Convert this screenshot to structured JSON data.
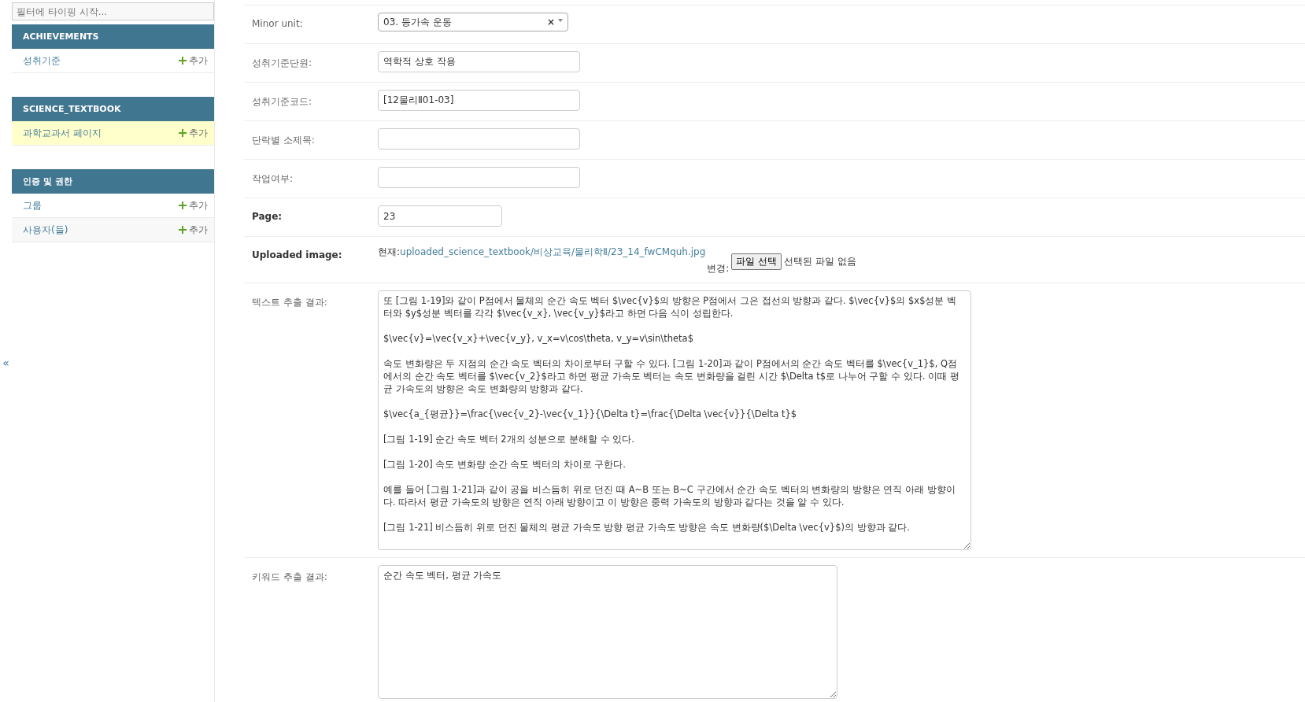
{
  "collapse_toggle": "«",
  "sidebar": {
    "filter": {
      "placeholder": "필터에 타이핑 시작..."
    },
    "sections": [
      {
        "caption": "ACHIEVEMENTS",
        "items": [
          {
            "name": "성취기준",
            "add": "추가",
            "selected": false
          }
        ]
      },
      {
        "caption": "SCIENCE_TEXTBOOK",
        "items": [
          {
            "name": "과학교과서 페이지",
            "add": "추가",
            "selected": true
          }
        ]
      },
      {
        "caption": "인증 및 권한",
        "items": [
          {
            "name": "그룹",
            "add": "추가",
            "selected": false
          },
          {
            "name": "사용자(들)",
            "add": "추가",
            "selected": false
          }
        ]
      }
    ]
  },
  "form": {
    "fields": [
      {
        "kind": "select",
        "label": "Minor unit:",
        "required": false,
        "value": "03. 등가속 운동",
        "clear": "×"
      },
      {
        "kind": "text",
        "label": "성취기준단원:",
        "required": false,
        "value": "역학적 상호 작용"
      },
      {
        "kind": "text",
        "label": "성취기준코드:",
        "required": false,
        "value": "[12물리Ⅱ01-03]"
      },
      {
        "kind": "text",
        "label": "단락별 소제목:",
        "required": false
      },
      {
        "kind": "text",
        "label": "작업여부:",
        "required": false
      },
      {
        "kind": "number",
        "label": "Page:",
        "required": true,
        "value": "23"
      },
      {
        "kind": "file",
        "label": "Uploaded image:",
        "required": true,
        "current_label": "현재:",
        "current_link": "uploaded_science_textbook/비상교육/물리학Ⅱ/23_14_fwCMquh.jpg",
        "change_label": "변경:",
        "button": "파일 선택",
        "status": "선택된 파일 없음"
      },
      {
        "kind": "textarea",
        "label": "텍스트 추출 결과:",
        "required": false,
        "value": "또 [그림 1-19]와 같이 P점에서 물체의 순간 속도 벡터 $\\vec{v}$의 방향은 P점에서 그은 접선의 방향과 같다. $\\vec{v}$의 $x$성분 벡터와 $y$성분 벡터를 각각 $\\vec{v_x}, \\vec{v_y}$라고 하면 다음 식이 성립한다.\n\n$\\vec{v}=\\vec{v_x}+\\vec{v_y}, v_x=v\\cos\\theta, v_y=v\\sin\\theta$\n\n속도 변화량은 두 지점의 순간 속도 벡터의 차이로부터 구할 수 있다. [그림 1-20]과 같이 P점에서의 순간 속도 벡터를 $\\vec{v_1}$, Q점에서의 순간 속도 벡터를 $\\vec{v_2}$라고 하면 평균 가속도 벡터는 속도 변화량을 걸린 시간 $\\Delta t$로 나누어 구할 수 있다. 이때 평균 가속도의 방향은 속도 변화량의 방향과 같다.\n\n$\\vec{a_{평균}}=\\frac{\\vec{v_2}-\\vec{v_1}}{\\Delta t}=\\frac{\\Delta \\vec{v}}{\\Delta t}$\n\n[그림 1-19] 순간 속도 벡터 2개의 성분으로 분해할 수 있다.\n\n[그림 1-20] 속도 변화량 순간 속도 벡터의 차이로 구한다.\n\n예를 들어 [그림 1-21]과 같이 공을 비스듬히 위로 던진 때 A~B 또는 B~C 구간에서 순간 속도 벡터의 변화량의 방향은 연직 아래 방향이다. 따라서 평균 가속도의 방향은 연직 아래 방향이고 이 방향은 중력 가속도의 방향과 같다는 것을 알 수 있다.\n\n[그림 1-21] 비스듬히 위로 던진 물체의 평균 가속도 방향 평균 가속도 방향은 속도 변화량($\\Delta \\vec{v}$)의 방향과 같다."
      },
      {
        "kind": "textarea_small",
        "label": "키워드 추출 결과:",
        "required": false,
        "value": "순간 속도 벡터, 평균 가속도"
      }
    ]
  }
}
